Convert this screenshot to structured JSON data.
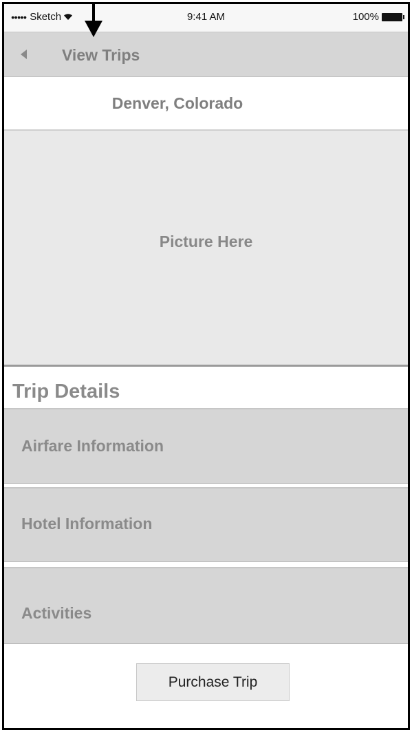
{
  "status_bar": {
    "carrier": "Sketch",
    "signal_dots": "●●●●●",
    "wifi_icon": "wifi-icon",
    "time": "9:41 AM",
    "battery_percent": "100%"
  },
  "nav_bar": {
    "back_icon": "back-arrow-icon",
    "title": "View Trips"
  },
  "location": {
    "title": "Denver, Colorado"
  },
  "picture": {
    "placeholder": "Picture Here"
  },
  "trip_details": {
    "heading": "Trip Details",
    "rows": [
      {
        "label": "Airfare Information"
      },
      {
        "label": "Hotel Information"
      },
      {
        "label": "Activities"
      }
    ]
  },
  "purchase": {
    "label": "Purchase Trip"
  },
  "colors": {
    "nav_bg": "#d6d6d6",
    "row_bg": "#d6d6d6",
    "picture_bg": "#e9e9e9",
    "muted_text": "#8a8a8a",
    "frame": "#000000"
  }
}
